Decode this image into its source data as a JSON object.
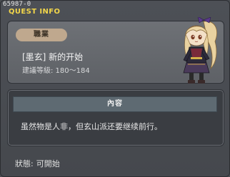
{
  "window": {
    "quest_id": "65987-0",
    "title": "QUEST INFO"
  },
  "quest": {
    "job_badge": "職業",
    "name": "[墨玄] 新的开始",
    "level_requirement": "建議等級: 180～184"
  },
  "content": {
    "header": "內容",
    "text": "虽然物是人非，但玄山派还要继续前行。"
  },
  "status": {
    "label": "狀態:",
    "value": "可開始"
  },
  "colors": {
    "title": "#f2d64a",
    "badge": "#bfa88e",
    "content_header": "#5e6a72"
  }
}
